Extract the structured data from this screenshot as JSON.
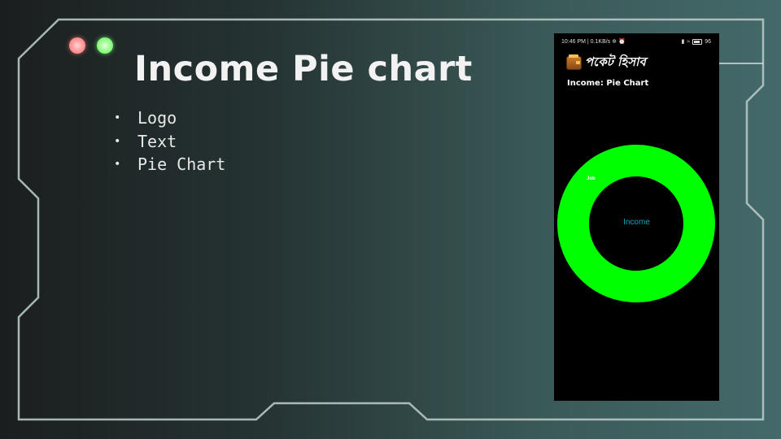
{
  "slide": {
    "title": "Income Pie chart",
    "bullets": [
      {
        "label": "Logo"
      },
      {
        "label": "Text"
      },
      {
        "label": "Pie Chart"
      }
    ]
  },
  "colors": {
    "frame": "#b8c6c6",
    "dot_red": "#ff8a8a",
    "dot_green": "#8dff7f",
    "slice_job": "#00ff00",
    "center_label": "#16a3b8"
  },
  "phone": {
    "status_left": "10:46 PM | 0.1KB/s ✲ ⏰",
    "status_right": "96",
    "logo_icon": "wallet-icon",
    "logo_text": "পকেট হিসাব",
    "heading": "Income: Pie Chart",
    "chart_center_label": "Income"
  },
  "chart_data": {
    "type": "pie",
    "title": "",
    "center_label": "Income",
    "slices": [
      {
        "label": "Job",
        "value": 100,
        "color": "#00ff00"
      }
    ]
  }
}
